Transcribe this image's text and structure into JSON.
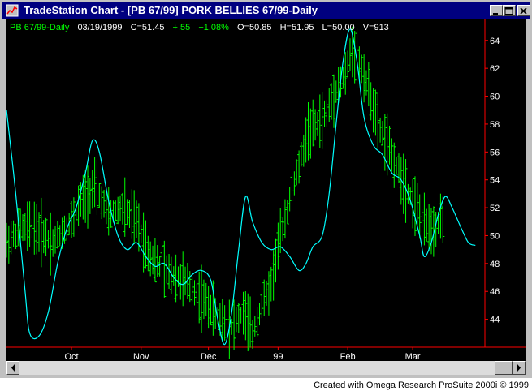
{
  "window": {
    "title": "TradeStation Chart - [PB 67/99] PORK BELLIES 67/99-Daily"
  },
  "info_bar": {
    "symbol": "PB 67/99-Daily",
    "date": "03/19/1999",
    "close": "C=51.45",
    "change": "+.55",
    "change_pct": "+1.08%",
    "open": "O=50.85",
    "high": "H=51.95",
    "low": "L=50.00",
    "volume": "V=913"
  },
  "footer": {
    "credit": "Created with Omega Research ProSuite 2000i © 1999"
  },
  "colors": {
    "background": "#000000",
    "bars": "#00ff00",
    "indicator": "#00ffff",
    "axis": "#ff0000",
    "labels": "#ffffff"
  },
  "chart_data": {
    "type": "line",
    "title": "",
    "xlabel": "",
    "ylabel": "",
    "ylim": [
      42,
      65.5
    ],
    "y_ticks": [
      44,
      46,
      48,
      50,
      52,
      54,
      56,
      58,
      60,
      62,
      64
    ],
    "x_ticks": [
      {
        "label": "Oct",
        "day": 28
      },
      {
        "label": "Nov",
        "day": 58
      },
      {
        "label": "Dec",
        "day": 87
      },
      {
        "label": "99",
        "day": 117
      },
      {
        "label": "Feb",
        "day": 147
      },
      {
        "label": "Mar",
        "day": 175
      }
    ],
    "x_range": [
      0,
      204
    ],
    "price_keypoints": [
      [
        0,
        49.5
      ],
      [
        6,
        50.5
      ],
      [
        12,
        50.6
      ],
      [
        20,
        49.5
      ],
      [
        28,
        51.0
      ],
      [
        32,
        52.5
      ],
      [
        38,
        53.5
      ],
      [
        44,
        51.5
      ],
      [
        50,
        52.0
      ],
      [
        56,
        51.0
      ],
      [
        62,
        48.5
      ],
      [
        68,
        47.5
      ],
      [
        74,
        47.0
      ],
      [
        80,
        46.2
      ],
      [
        86,
        45.2
      ],
      [
        92,
        44.0
      ],
      [
        97,
        43.5
      ],
      [
        102,
        44.5
      ],
      [
        106,
        43.0
      ],
      [
        110,
        45.0
      ],
      [
        114,
        46.5
      ],
      [
        118,
        50.0
      ],
      [
        122,
        52.5
      ],
      [
        126,
        55.0
      ],
      [
        130,
        57.5
      ],
      [
        134,
        58.0
      ],
      [
        138,
        58.8
      ],
      [
        142,
        60.5
      ],
      [
        146,
        61.5
      ],
      [
        149,
        63.5
      ],
      [
        153,
        62.0
      ],
      [
        156,
        60.5
      ],
      [
        160,
        58.0
      ],
      [
        164,
        56.5
      ],
      [
        168,
        55.0
      ],
      [
        172,
        53.5
      ],
      [
        176,
        52.2
      ],
      [
        180,
        50.8
      ],
      [
        184,
        50.5
      ],
      [
        188,
        51.45
      ]
    ],
    "series": [
      {
        "values": [
          [
            0,
            59.0
          ],
          [
            4,
            53.0
          ],
          [
            8,
            46.0
          ],
          [
            10,
            43.0
          ],
          [
            14,
            42.8
          ],
          [
            18,
            44.5
          ],
          [
            22,
            48.0
          ],
          [
            26,
            50.5
          ],
          [
            30,
            52.0
          ],
          [
            34,
            54.5
          ],
          [
            37,
            56.8
          ],
          [
            40,
            56.0
          ],
          [
            44,
            52.5
          ],
          [
            48,
            50.0
          ],
          [
            52,
            49.0
          ],
          [
            56,
            49.5
          ],
          [
            60,
            48.5
          ],
          [
            64,
            47.8
          ],
          [
            68,
            48.0
          ],
          [
            72,
            47.0
          ],
          [
            76,
            46.5
          ],
          [
            80,
            47.2
          ],
          [
            84,
            47.5
          ],
          [
            88,
            46.8
          ],
          [
            91,
            44.0
          ],
          [
            94,
            42.2
          ],
          [
            97,
            44.5
          ],
          [
            100,
            49.0
          ],
          [
            103,
            52.8
          ],
          [
            106,
            51.0
          ],
          [
            110,
            49.5
          ],
          [
            114,
            49.0
          ],
          [
            118,
            49.2
          ],
          [
            122,
            48.5
          ],
          [
            126,
            47.5
          ],
          [
            129,
            48.0
          ],
          [
            132,
            49.2
          ],
          [
            136,
            50.0
          ],
          [
            139,
            53.0
          ],
          [
            142,
            58.0
          ],
          [
            145,
            62.5
          ],
          [
            148,
            64.8
          ],
          [
            151,
            62.5
          ],
          [
            154,
            58.5
          ],
          [
            158,
            56.5
          ],
          [
            162,
            55.8
          ],
          [
            166,
            54.5
          ],
          [
            170,
            54.0
          ],
          [
            174,
            52.5
          ],
          [
            178,
            50.0
          ],
          [
            180,
            48.5
          ],
          [
            183,
            49.5
          ],
          [
            186,
            51.5
          ],
          [
            189,
            52.8
          ],
          [
            192,
            52.0
          ],
          [
            196,
            50.5
          ],
          [
            199,
            49.5
          ],
          [
            202,
            49.3
          ]
        ]
      }
    ]
  }
}
